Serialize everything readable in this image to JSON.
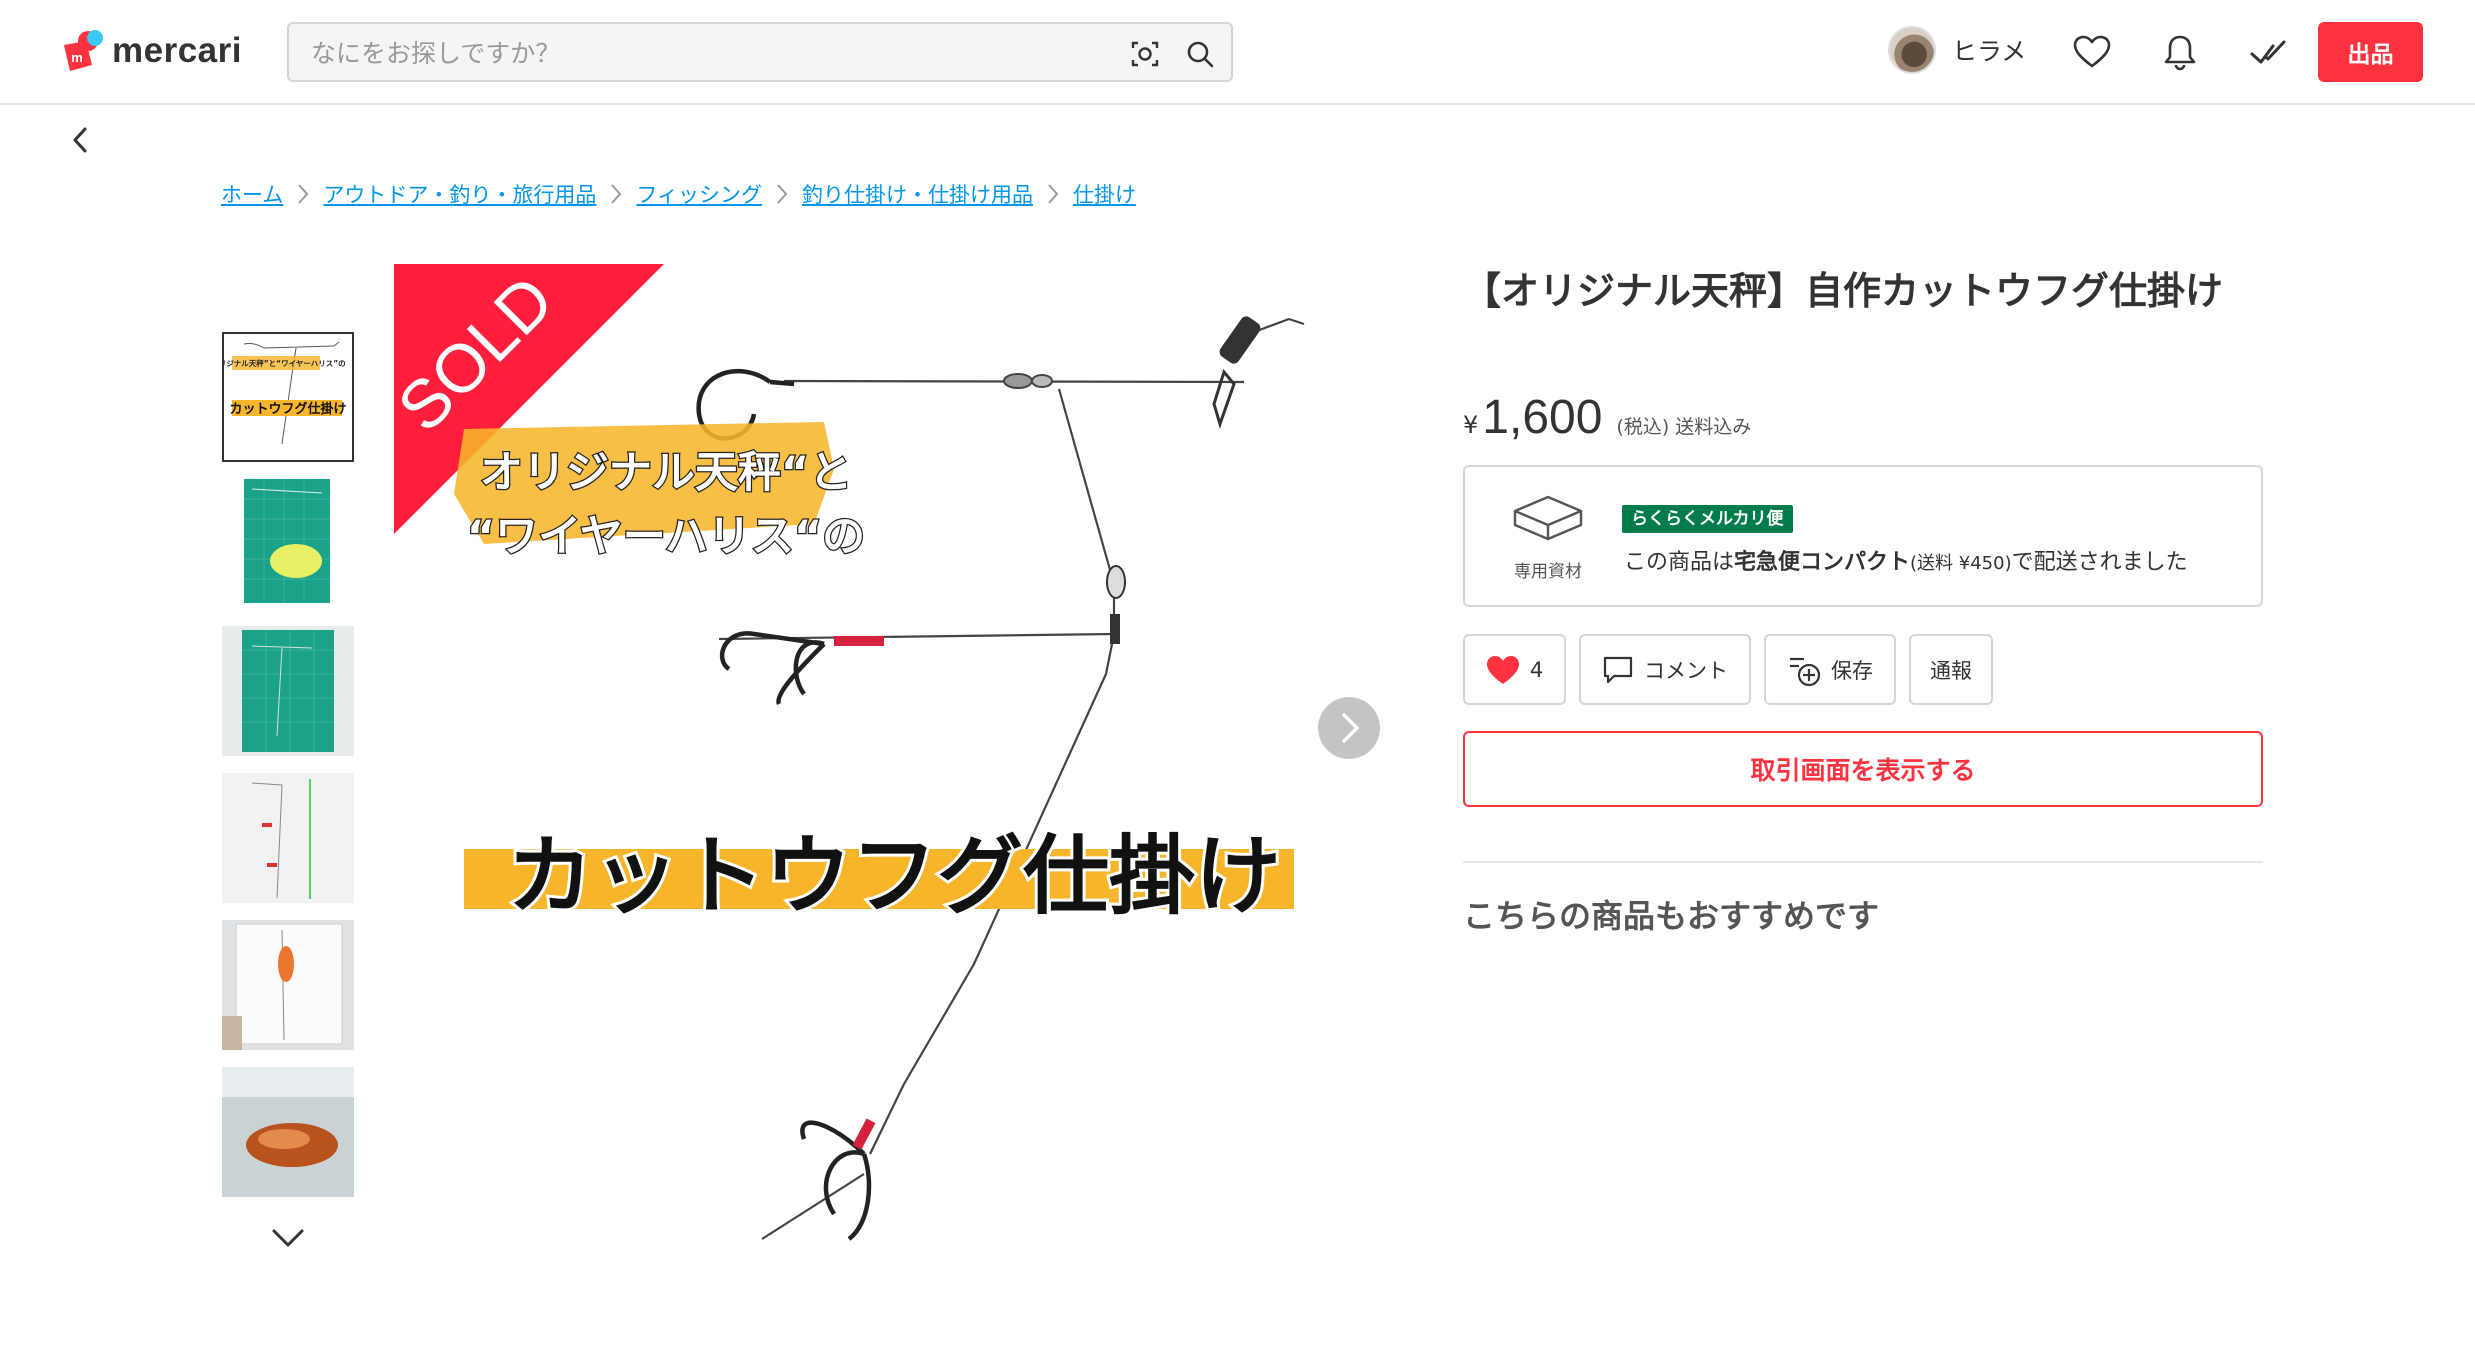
{
  "header": {
    "logo_text": "mercari",
    "search_placeholder": "なにをお探しですか？",
    "username": "ヒラメ",
    "sell_label": "出品"
  },
  "breadcrumb": [
    "ホーム",
    "アウトドア・釣り・旅行用品",
    "フィッシング",
    "釣り仕掛け・仕掛け用品",
    "仕掛け"
  ],
  "main_image": {
    "sold_label": "SOLD",
    "caption_line1": "オリジナル天秤“と",
    "caption_line2": "“ワイヤーハリス“の",
    "caption_main": "カットウフグ仕掛け"
  },
  "thumbnail_captions": {
    "thumb1_top": "“オリジナル天秤”と“ワイヤーハリス”の",
    "thumb1_main": "カットウフグ仕掛け"
  },
  "item": {
    "title": "【オリジナル天秤】自作カットウフグ仕掛け",
    "price_symbol": "¥",
    "price": "1,600",
    "price_note": "(税込) 送料込み"
  },
  "shipping": {
    "icon_label": "専用資材",
    "badge": "らくらくメルカリ便",
    "text_prefix": "この商品は",
    "method": "宅急便コンパクト",
    "fee": "(送料 ¥450)",
    "text_suffix": "で配送されました"
  },
  "actions": {
    "like_count": "4",
    "comment_label": "コメント",
    "save_label": "保存",
    "report_label": "通報"
  },
  "trade_button_label": "取引画面を表示する",
  "recommend_title": "こちらの商品もおすすめです",
  "colors": {
    "brand_red": "#ff333f",
    "link_blue": "#0095ee",
    "ship_badge_green": "#007d4a",
    "banner_yellow": "#f7b52c"
  }
}
